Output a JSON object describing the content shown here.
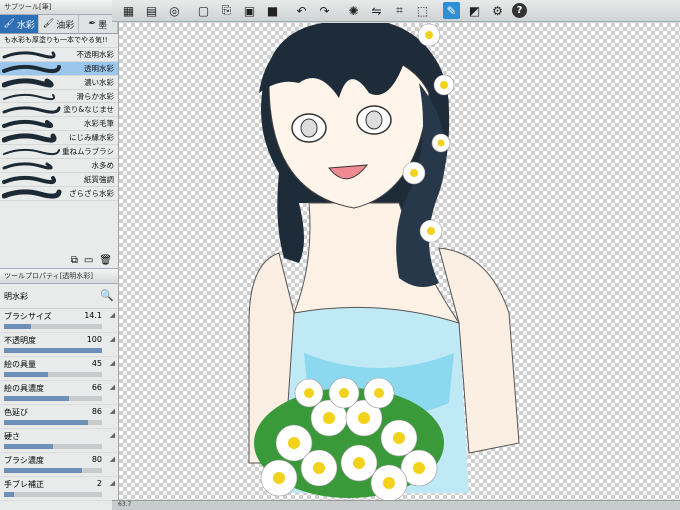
{
  "toolbar": {
    "buttons": [
      {
        "icon": "layer-window-icon"
      },
      {
        "icon": "layer-menu-icon"
      },
      {
        "icon": "swirl-icon"
      },
      {
        "icon": "new-canvas-icon"
      },
      {
        "icon": "open-file-icon"
      },
      {
        "icon": "save-icon"
      },
      {
        "icon": "color-box-icon"
      },
      {
        "icon": "undo-icon"
      },
      {
        "icon": "redo-icon"
      },
      {
        "icon": "brightness-icon"
      },
      {
        "icon": "flip-icon"
      },
      {
        "icon": "transform-icon"
      },
      {
        "icon": "selection-icon"
      },
      {
        "icon": "pen-icon"
      },
      {
        "icon": "ruler-icon"
      },
      {
        "icon": "gear-icon"
      }
    ],
    "help_label": "?"
  },
  "subtool": {
    "panel_title": "サブツール[筆]",
    "tabs": [
      {
        "label": "水彩",
        "icon": "watercolor-brush-icon",
        "active": true
      },
      {
        "label": "油彩",
        "icon": "oil-brush-icon",
        "active": false
      },
      {
        "label": "墨",
        "icon": "ink-brush-icon",
        "active": false
      }
    ],
    "brushes": [
      {
        "label": "も水彩も厚塗りも一本でやる気!!",
        "selected": false
      },
      {
        "label": "不透明水彩",
        "selected": false
      },
      {
        "label": "透明水彩",
        "selected": true
      },
      {
        "label": "濃い水彩",
        "selected": false
      },
      {
        "label": "滑らか水彩",
        "selected": false
      },
      {
        "label": "塗り&なじませ",
        "selected": false
      },
      {
        "label": "水彩毛筆",
        "selected": false
      },
      {
        "label": "にじみ縁水彩",
        "selected": false
      },
      {
        "label": "重ねムラブラシ",
        "selected": false
      },
      {
        "label": "水多め",
        "selected": false
      },
      {
        "label": "紙質強調",
        "selected": false
      },
      {
        "label": "ざらざら水彩",
        "selected": false
      }
    ]
  },
  "properties": {
    "panel_title": "ツールプロパティ[透明水彩]",
    "brush_name": "明水彩",
    "rows": [
      {
        "label": "ブラシサイズ",
        "value": "14.1",
        "fraction": 0.28
      },
      {
        "label": "不透明度",
        "value": "100",
        "fraction": 1.0
      },
      {
        "label": "絵の具量",
        "value": "45",
        "fraction": 0.45
      },
      {
        "label": "絵の具濃度",
        "value": "66",
        "fraction": 0.66
      },
      {
        "label": "色延び",
        "value": "86",
        "fraction": 0.86
      },
      {
        "label": "硬さ",
        "value": "",
        "fraction": 0.5
      },
      {
        "label": "ブラシ濃度",
        "value": "80",
        "fraction": 0.8
      },
      {
        "label": "手ブレ補正",
        "value": "2",
        "fraction": 0.1
      }
    ]
  },
  "status": {
    "zoom": "63.7"
  }
}
